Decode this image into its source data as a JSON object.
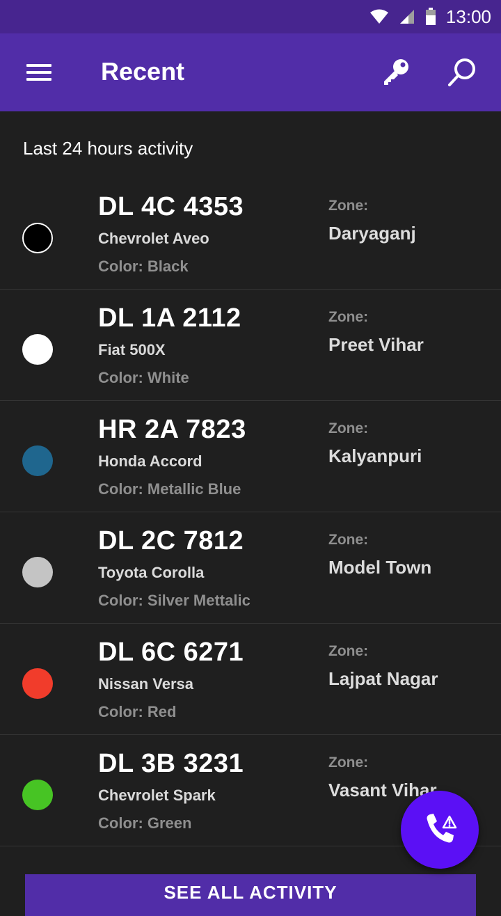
{
  "status_bar": {
    "time": "13:00"
  },
  "app_bar": {
    "title": "Recent"
  },
  "section": {
    "title": "Last 24 hours activity"
  },
  "vehicles": [
    {
      "plate": "DL 4C 4353",
      "model": "Chevrolet Aveo",
      "color_label": "Color: Black",
      "zone_label": "Zone:",
      "zone": "Daryaganj",
      "swatch": "#000000"
    },
    {
      "plate": "DL 1A 2112",
      "model": "Fiat 500X",
      "color_label": "Color: White",
      "zone_label": "Zone:",
      "zone": "Preet Vihar",
      "swatch": "#ffffff"
    },
    {
      "plate": "HR 2A 7823",
      "model": "Honda Accord",
      "color_label": "Color: Metallic Blue",
      "zone_label": "Zone:",
      "zone": "Kalyanpuri",
      "swatch": "#1f668e"
    },
    {
      "plate": "DL 2C 7812",
      "model": "Toyota Corolla",
      "color_label": "Color: Silver Mettalic",
      "zone_label": "Zone:",
      "zone": "Model Town",
      "swatch": "#c4c4c4"
    },
    {
      "plate": "DL 6C 6271",
      "model": "Nissan Versa",
      "color_label": "Color: Red",
      "zone_label": "Zone:",
      "zone": "Lajpat Nagar",
      "swatch": "#f13c2b"
    },
    {
      "plate": "DL 3B 3231",
      "model": "Chevrolet Spark",
      "color_label": "Color: Green",
      "zone_label": "Zone:",
      "zone": "Vasant Vihar",
      "swatch": "#47c424"
    }
  ],
  "see_all": {
    "label": "SEE ALL ACTIVITY"
  },
  "icons": {
    "menu": "menu-icon",
    "key": "key-icon",
    "search": "search-icon",
    "fab": "emergency-call-icon",
    "wifi": "wifi-icon",
    "signal": "signal-icon",
    "battery": "battery-icon"
  },
  "colors": {
    "status_bar": "#47258f",
    "app_bar": "#512da8",
    "background": "#1f1f1f",
    "fab": "#5b10f5"
  }
}
